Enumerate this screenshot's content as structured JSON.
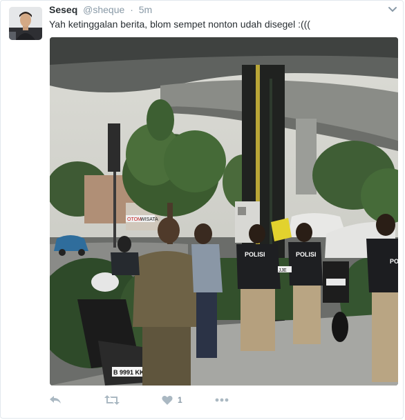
{
  "tweet": {
    "display_name": "Seseq",
    "handle": "@sheque",
    "separator": "·",
    "time": "5m",
    "text": "Yah ketinggalan berita, blom sempet nonton udah disegel :(((",
    "media": {
      "sign_text": "WISATA",
      "sign_red": "OTOM",
      "vest_label": "POLISI",
      "plate_1": "JJE",
      "plate_2": "B 9991 KKF"
    },
    "actions": {
      "reply_icon": "reply-icon",
      "retweet_icon": "retweet-icon",
      "like_icon": "heart-icon",
      "like_count": "1",
      "more_icon": "more-icon"
    }
  },
  "colors": {
    "name": "#292f33",
    "meta": "#8899a6",
    "action_icon": "#aab8c2",
    "border": "#e1e8ed"
  }
}
